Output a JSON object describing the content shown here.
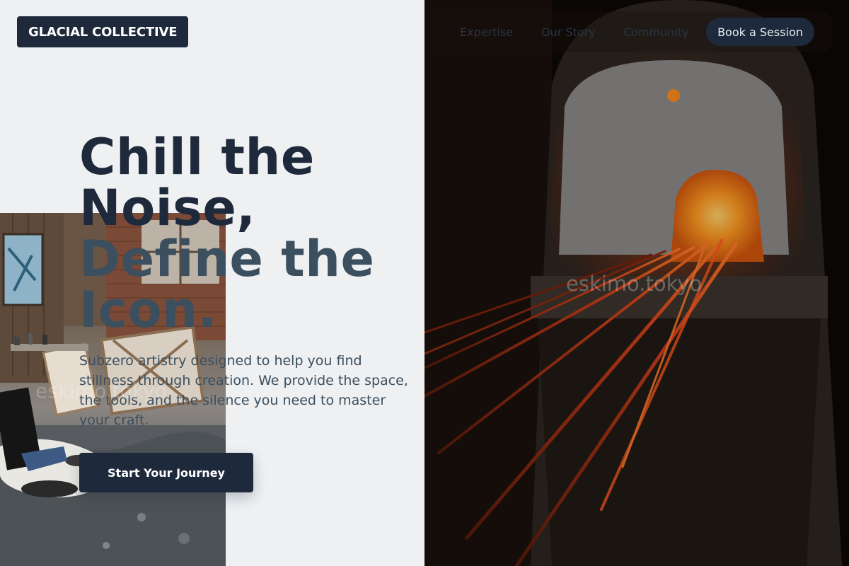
{
  "brand": {
    "logo_text": "GLACIAL COLLECTIVE"
  },
  "nav": {
    "links": [
      "Expertise",
      "Our Story",
      "Community"
    ],
    "cta_label": "Book a Session"
  },
  "hero": {
    "title_lines": [
      "Chill the",
      "Noise,",
      "Define the",
      "Icon."
    ],
    "subtitle": "Subzero artistry designed to help you find stillness through creation. We provide the space, the tools, and the silence you need to master your craft.",
    "cta_label": "Start Your Journey"
  },
  "images": {
    "left_watermark": "eskimo.tokyo",
    "right_watermark": "eskimo.tokyo"
  },
  "colors": {
    "primary": "#1e293b",
    "secondary_text": "#3b4f5e",
    "background": "#eef0f2",
    "furnace_glow": "#ff8a1e"
  }
}
